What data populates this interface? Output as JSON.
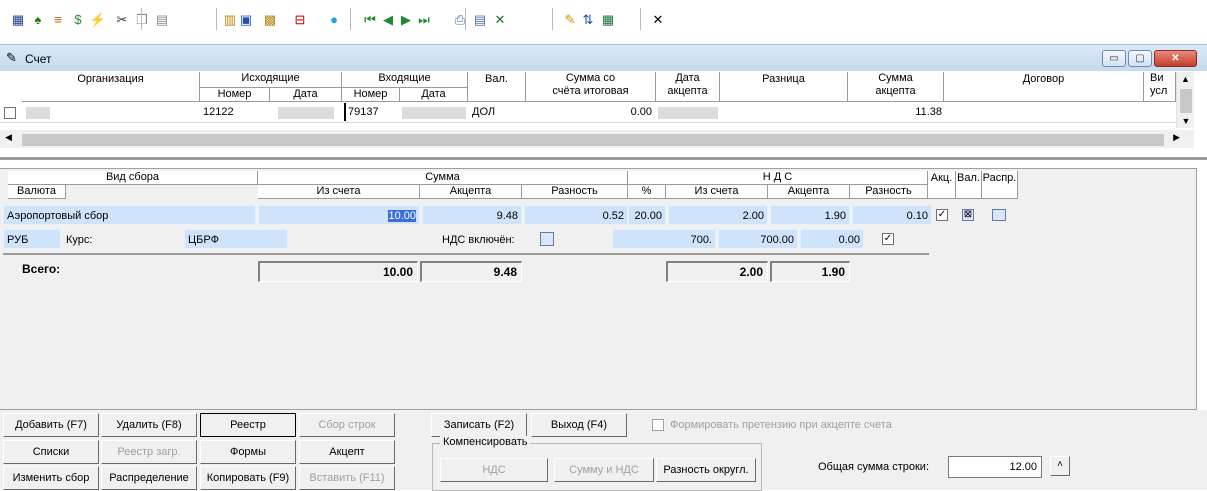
{
  "toolbar": {
    "buttons": [
      {
        "icon": "calculator-icon",
        "glyph": "▦",
        "color": "#1c3f94"
      },
      {
        "icon": "money-bag-icon",
        "glyph": "♠",
        "color": "#2a7a1c"
      },
      {
        "icon": "list-icon",
        "glyph": "≡",
        "color": "#b26b00"
      },
      {
        "icon": "dollar-icon",
        "glyph": "$",
        "color": "#2c8a2c"
      },
      {
        "icon": "lightning-icon",
        "glyph": "⚡",
        "color": "#d9b600"
      },
      {
        "icon": "cut-icon",
        "glyph": "✂",
        "color": "#333333"
      },
      {
        "icon": "copy-icon",
        "glyph": "❐",
        "color": "#888888"
      },
      {
        "icon": "paste-icon",
        "glyph": "▤",
        "color": "#888888"
      },
      {
        "icon": "copy-record-icon",
        "glyph": "▥",
        "color": "#b8860b"
      },
      {
        "icon": "save-icon",
        "glyph": "▣",
        "color": "#1f4fa8"
      },
      {
        "icon": "grid-icon",
        "glyph": "▩",
        "color": "#b8860b"
      },
      {
        "icon": "delete-record-icon",
        "glyph": "⊟",
        "color": "#c00000"
      },
      {
        "icon": "edit-icon",
        "glyph": "●",
        "color": "#1aa3d8"
      },
      {
        "icon": "first-record-icon",
        "glyph": "⏮",
        "color": "#1f8a2f"
      },
      {
        "icon": "prev-record-icon",
        "glyph": "◀",
        "color": "#1f8a2f"
      },
      {
        "icon": "next-record-icon",
        "glyph": "▶",
        "color": "#1f8a2f"
      },
      {
        "icon": "last-record-icon",
        "glyph": "⏭",
        "color": "#1f8a2f"
      },
      {
        "icon": "print-icon",
        "glyph": "⎙",
        "color": "#4a6fa0"
      },
      {
        "icon": "preview-icon",
        "glyph": "▤",
        "color": "#4a6fa0"
      },
      {
        "icon": "excel-icon",
        "glyph": "✕",
        "color": "#1d6f3a"
      },
      {
        "icon": "filter-icon",
        "glyph": "✎",
        "color": "#d98a00"
      },
      {
        "icon": "sort-icon",
        "glyph": "⇅",
        "color": "#1f4fa8"
      },
      {
        "icon": "calc-grid-icon",
        "glyph": "▦",
        "color": "#1d6f3a"
      },
      {
        "icon": "close-icon",
        "glyph": "✕",
        "color": "#000000"
      }
    ]
  },
  "window": {
    "title": "Счет",
    "min_label": "▭",
    "max_label": "▢",
    "close_label": "✕"
  },
  "grid1": {
    "headers": {
      "org": "Организация",
      "outgoing": "Исходящие",
      "incoming": "Входящие",
      "number": "Номер",
      "date": "Дата",
      "currency": "Вал.",
      "sum_total_1": "Сумма со",
      "sum_total_2": "счёта итоговая",
      "accept_date_1": "Дата",
      "accept_date_2": "акцепта",
      "diff": "Разница",
      "sum_accept_1": "Сумма",
      "sum_accept_2": "акцепта",
      "contract": "Договор",
      "service_1": "Ви",
      "service_2": "усл"
    },
    "row": {
      "out_number": "12122",
      "in_number": "79137",
      "currency": "ДОЛ",
      "sum_total": "0.00",
      "sum_accept": "11.38"
    }
  },
  "detail": {
    "headers": {
      "fee_type": "Вид сбора",
      "currency": "Валюта",
      "sum": "Сумма",
      "from_invoice": "Из счета",
      "accept": "Акцепта",
      "diff": "Разность",
      "vat": "Н Д С",
      "percent": "%",
      "vat_from_invoice": "Из счета",
      "vat_accept": "Акцепта",
      "vat_diff": "Разность",
      "akc": "Акц.",
      "val": "Вал.",
      "distr": "Распр."
    },
    "row": {
      "fee_type": "Аэропортовый сбор",
      "from_invoice": "10.00",
      "accept": "9.48",
      "diff": "0.52",
      "percent": "20.00",
      "vat_from_invoice": "2.00",
      "vat_accept": "1.90",
      "vat_diff": "0.10"
    },
    "row2": {
      "currency": "РУБ",
      "rate_label": "Курс:",
      "rate_source": "ЦБРФ",
      "vat_included_label": "НДС включён:",
      "val_a": "700.",
      "val_b": "700.00",
      "val_c": "0.00"
    },
    "totals": {
      "label": "Всего:",
      "from_invoice": "10.00",
      "accept": "9.48",
      "vat_from_invoice": "2.00",
      "vat_accept": "1.90"
    }
  },
  "buttons": {
    "add": "Добавить (F7)",
    "delete": "Удалить (F8)",
    "registry": "Реестр",
    "collect_rows": "Сбор строк",
    "save": "Записать (F2)",
    "exit": "Выход (F4)",
    "claim_label": "Формировать претензию при акцепте счета",
    "lists": "Списки",
    "registry_load": "Реестр загр.",
    "forms": "Формы",
    "accept": "Акцепт",
    "change_fee": "Изменить сбор",
    "distribution": "Распределение",
    "copy": "Копировать (F9)",
    "insert": "Вставить (F11)",
    "compensate_label": "Компенсировать",
    "vat": "НДС",
    "sum_and_vat": "Сумму и НДС",
    "rounding_diff": "Разность округл.",
    "row_total_label": "Общая сумма строки:",
    "row_total_value": "12.00"
  },
  "colors": {
    "field_bg": "#cfe3fb",
    "titlebar": "#c6d9ee",
    "selection": "#3a6fd8"
  }
}
